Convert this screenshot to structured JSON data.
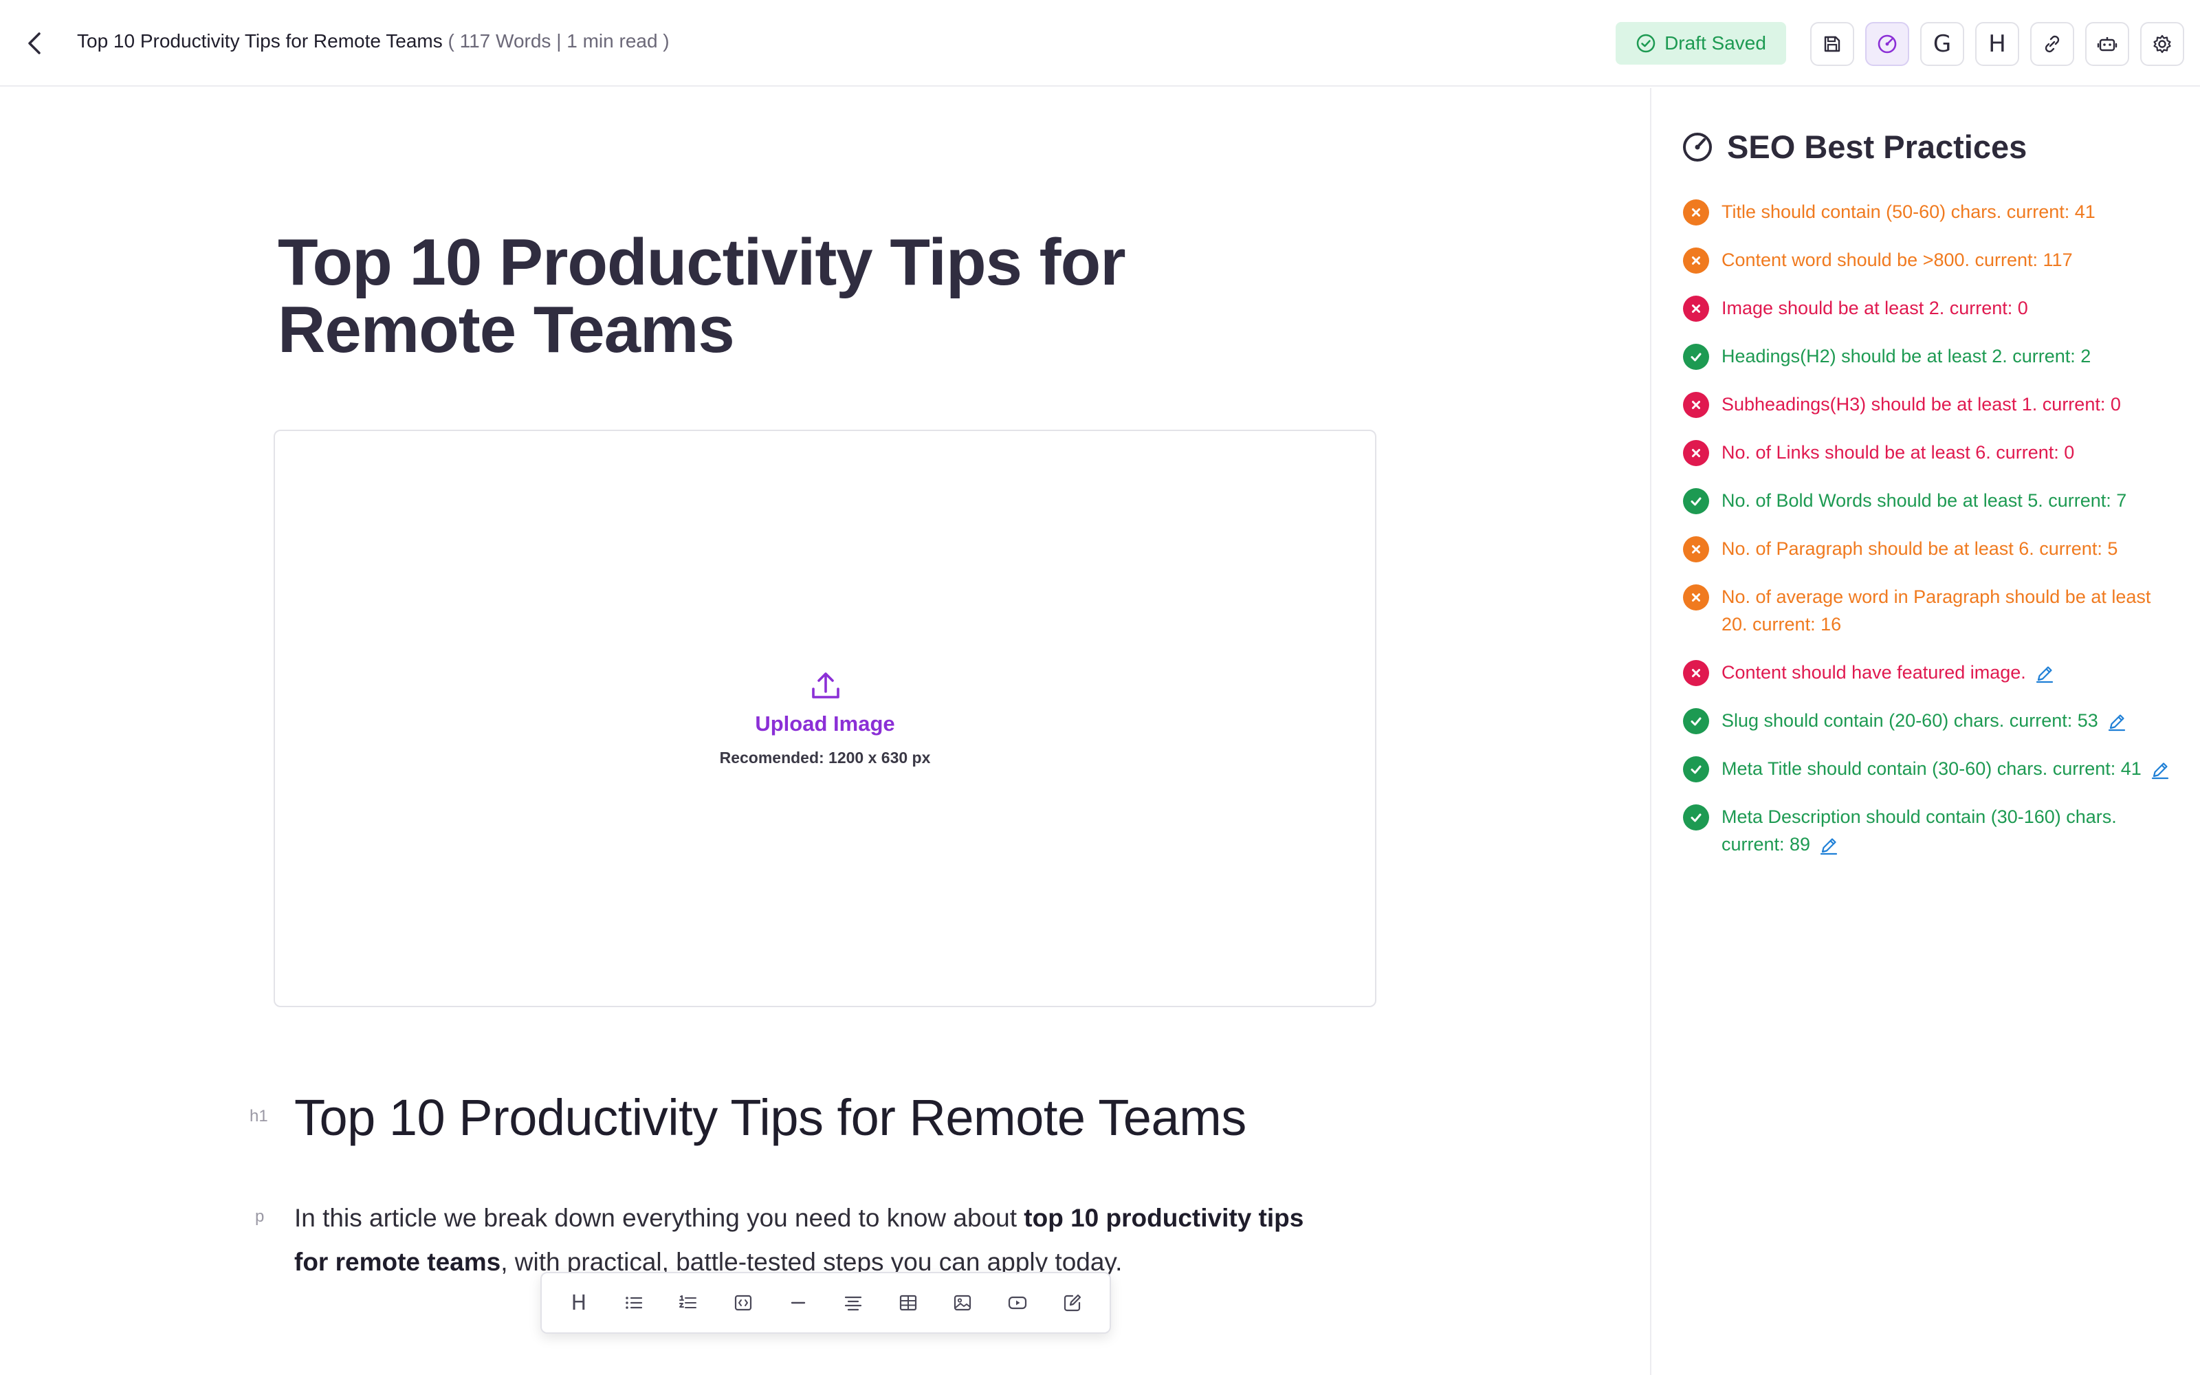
{
  "header": {
    "title": "Top 10 Productivity Tips for Remote Teams",
    "meta": " ( 117 Words | 1 min read )",
    "draft_status": "Draft Saved",
    "toolbar": [
      {
        "name": "save",
        "icon": "save-icon"
      },
      {
        "name": "seo",
        "icon": "gauge-icon",
        "active": true
      },
      {
        "name": "google",
        "icon": "google-icon",
        "label": "G"
      },
      {
        "name": "headings",
        "icon": "heading-icon",
        "label": "H"
      },
      {
        "name": "link",
        "icon": "link-icon"
      },
      {
        "name": "bot",
        "icon": "bot-icon"
      },
      {
        "name": "settings",
        "icon": "gear-icon"
      }
    ]
  },
  "editor": {
    "title": "Top 10 Productivity Tips for Remote Teams",
    "upload": {
      "label": "Upload Image",
      "recommendation": "Recomended: 1200 x 630 px"
    },
    "blocks": [
      {
        "tag": "h1",
        "text": "Top 10 Productivity Tips for Remote Teams"
      },
      {
        "tag": "p",
        "text_before": "In this article we break down everything you need to know about ",
        "bold": "top 10 productivity tips for remote teams",
        "text_after": ", with practical, battle-tested steps you can apply today."
      }
    ],
    "bottom_toolbar": [
      {
        "name": "heading",
        "icon": "heading-icon",
        "label": "H"
      },
      {
        "name": "bullet-list",
        "icon": "bullet-list-icon"
      },
      {
        "name": "ordered-list",
        "icon": "ordered-list-icon"
      },
      {
        "name": "code",
        "icon": "code-icon"
      },
      {
        "name": "divider",
        "icon": "horizontal-rule-icon"
      },
      {
        "name": "align",
        "icon": "align-center-icon"
      },
      {
        "name": "table",
        "icon": "table-icon"
      },
      {
        "name": "image",
        "icon": "image-icon"
      },
      {
        "name": "video",
        "icon": "video-icon"
      },
      {
        "name": "edit",
        "icon": "edit-icon"
      }
    ]
  },
  "seo": {
    "title": "SEO Best Practices",
    "colors": {
      "warn": "#f07a1f",
      "fail": "#e0194f",
      "pass": "#1d9a52"
    },
    "checks": [
      {
        "status": "warn",
        "text": "Title should contain (50-60) chars. current: 41"
      },
      {
        "status": "warn",
        "text": "Content word should be >800. current: 117"
      },
      {
        "status": "fail",
        "text": "Image should be at least 2. current: 0"
      },
      {
        "status": "pass",
        "text": "Headings(H2) should be at least 2. current: 2"
      },
      {
        "status": "fail",
        "text": "Subheadings(H3) should be at least 1. current: 0"
      },
      {
        "status": "fail",
        "text": "No. of Links should be at least 6. current: 0"
      },
      {
        "status": "pass",
        "text": "No. of Bold Words should be at least 5. current: 7"
      },
      {
        "status": "warn",
        "text": "No. of Paragraph should be at least 6. current: 5"
      },
      {
        "status": "warn",
        "text": "No. of average word in Paragraph should be at least 20. current: 16"
      },
      {
        "status": "fail",
        "text": "Content should have featured image.",
        "editable": true
      },
      {
        "status": "pass",
        "text": "Slug should contain (20-60) chars. current: 53",
        "editable": true
      },
      {
        "status": "pass",
        "text": "Meta Title should contain (30-60) chars. current: 41",
        "editable": true
      },
      {
        "status": "pass",
        "text": "Meta Description should contain (30-160) chars. current: 89",
        "editable": true
      }
    ]
  }
}
